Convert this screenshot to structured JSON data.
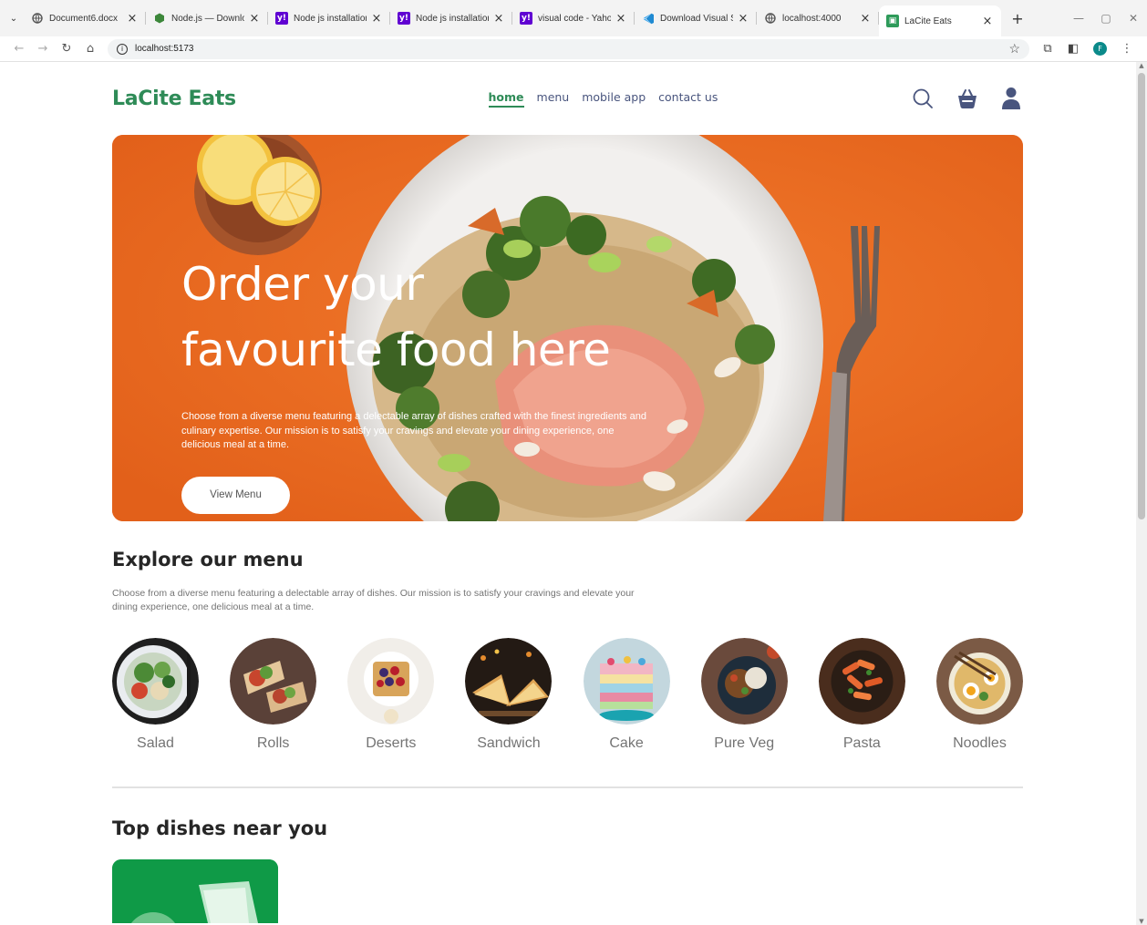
{
  "browser": {
    "tabs": [
      {
        "title": "Document6.docx",
        "favicon": "globe-icon",
        "color": "#555555"
      },
      {
        "title": "Node.js — Download",
        "favicon": "nodejs-icon",
        "color": "#3c873a"
      },
      {
        "title": "Node js installation -",
        "favicon": "yahoo-icon",
        "color": "#6001d2"
      },
      {
        "title": "Node js installation -",
        "favicon": "yahoo-icon",
        "color": "#6001d2"
      },
      {
        "title": "visual code - Yahoo !",
        "favicon": "yahoo-icon",
        "color": "#6001d2"
      },
      {
        "title": "Download Visual Stu",
        "favicon": "vscode-icon",
        "color": "#1f8ad2"
      },
      {
        "title": "localhost:4000",
        "favicon": "globe-icon",
        "color": "#555555"
      },
      {
        "title": "LaCite Eats",
        "favicon": "lacite-icon",
        "color": "#2e9b5a",
        "active": true
      }
    ],
    "url": "localhost:5173",
    "profile_initial": "F"
  },
  "navbar": {
    "logo": "LaCite Eats",
    "links": [
      "home",
      "menu",
      "mobile app",
      "contact us"
    ],
    "active_link": "home"
  },
  "hero": {
    "title_line1": "Order your",
    "title_line2": "favourite food here",
    "text": "Choose from a diverse menu featuring a delectable array of dishes crafted with the finest ingredients and culinary expertise. Our mission is to satisfy your cravings and elevate your dining experience, one delicious meal at a time.",
    "button": "View Menu"
  },
  "explore": {
    "title": "Explore our menu",
    "text": "Choose from a diverse menu featuring a delectable array of dishes. Our mission is to satisfy your cravings and elevate your dining experience, one delicious meal at a time.",
    "items": [
      {
        "label": "Salad"
      },
      {
        "label": "Rolls"
      },
      {
        "label": "Deserts"
      },
      {
        "label": "Sandwich"
      },
      {
        "label": "Cake"
      },
      {
        "label": "Pure Veg"
      },
      {
        "label": "Pasta"
      },
      {
        "label": "Noodles"
      }
    ]
  },
  "top_dishes": {
    "title": "Top dishes near you"
  },
  "colors": {
    "brand": "#2e8b57",
    "hero_bg": "#ef6c23",
    "nav_text": "#49557e"
  }
}
